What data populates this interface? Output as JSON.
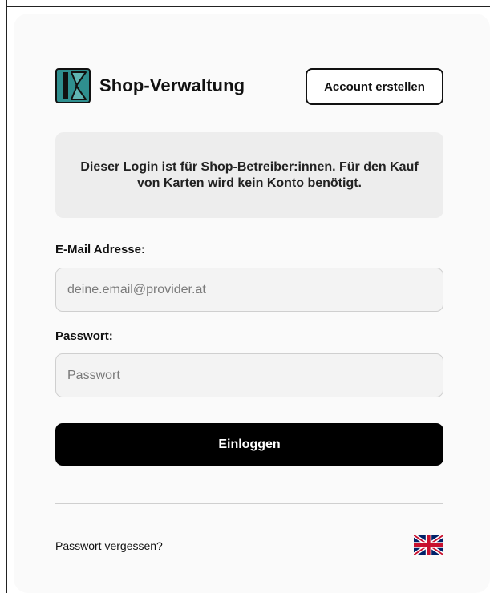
{
  "header": {
    "brand": "Shop-Verwaltung",
    "logo_icon": "shop-logo-icon",
    "create_account_label": "Account erstellen"
  },
  "notice": {
    "text": "Dieser Login ist für Shop-Betreiber:innen. Für den Kauf von Karten wird kein Konto benötigt."
  },
  "form": {
    "email_label": "E-Mail Adresse:",
    "email_placeholder": "deine.email@provider.at",
    "email_value": "",
    "password_label": "Passwort:",
    "password_placeholder": "Passwort",
    "password_value": "",
    "submit_label": "Einloggen"
  },
  "footer": {
    "forgot_label": "Passwort vergessen?",
    "language_icon": "uk-flag-icon"
  },
  "colors": {
    "brand_teal": "#2f8f8f",
    "button_black": "#000000",
    "notice_bg": "#ededed"
  }
}
